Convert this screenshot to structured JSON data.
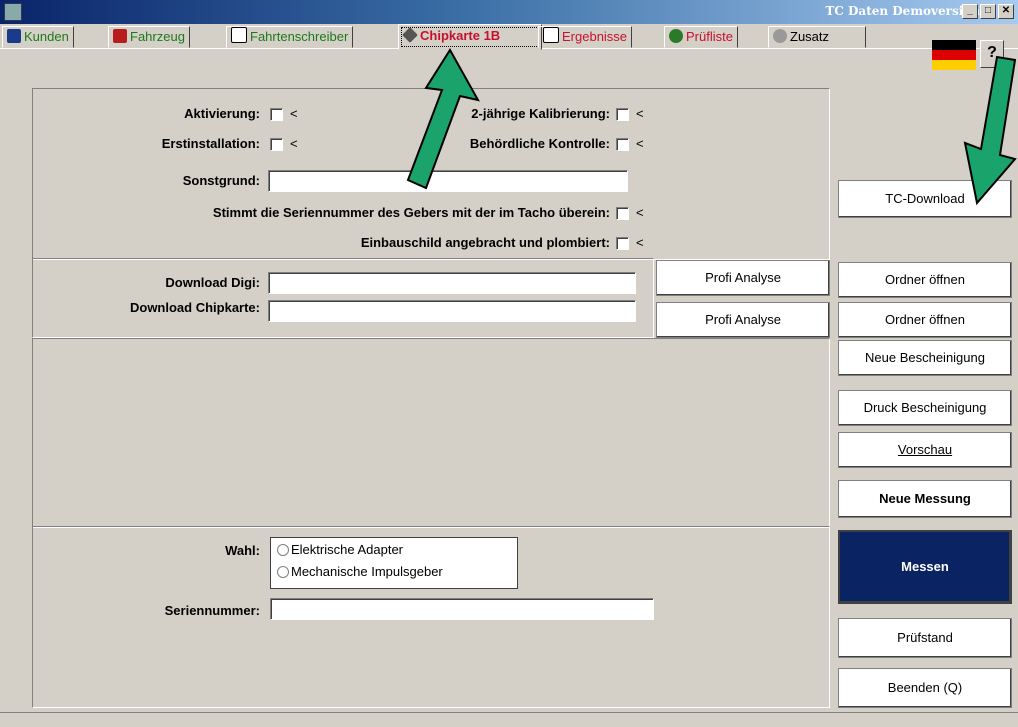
{
  "window": {
    "title": "TC Daten Demoversion",
    "min": "_",
    "max": "□",
    "close": "✕"
  },
  "tabs": [
    {
      "label": "Kunden",
      "icon": "customers-icon"
    },
    {
      "label": "Fahrzeug",
      "icon": "vehicle-icon"
    },
    {
      "label": "Fahrtenschreiber",
      "icon": "tachograph-icon"
    },
    {
      "label": "Chipkarte 1B",
      "icon": "chipcard-icon",
      "active": true
    },
    {
      "label": "Ergebnisse",
      "icon": "results-icon"
    },
    {
      "label": "Prüfliste",
      "icon": "checklist-icon"
    },
    {
      "label": "Zusatz",
      "icon": "extras-icon"
    }
  ],
  "help": "?",
  "section1": {
    "aktivierung": "Aktivierung:",
    "erstinstallation": "Erstinstallation:",
    "sonstgrund": "Sonstgrund:",
    "kalibrierung": "2-jährige Kalibrierung:",
    "kontrolle": "Behördliche Kontrolle:",
    "seriennummer_frage": "Stimmt die Seriennummer des Gebers mit der im Tacho überein:",
    "einbauschild": "Einbauschild angebracht und plombiert:",
    "lt": "<",
    "sonstgrund_value": ""
  },
  "downloads": {
    "digi_label": "Download Digi:",
    "chip_label": "Download Chipkarte:",
    "digi_value": "",
    "chip_value": "",
    "profi": "Profi Analyse"
  },
  "wahl": {
    "label": "Wahl:",
    "options": [
      "Elektrische Adapter",
      "Mechanische Impulsgeber"
    ],
    "serial_label": "Seriennummer:",
    "serial_value": ""
  },
  "buttons": {
    "tc_download": "TC-Download",
    "ordner1": "Ordner öffnen",
    "ordner2": "Ordner öffnen",
    "neue_bescheinigung": "Neue Bescheinigung",
    "druck_bescheinigung": "Druck Bescheinigung",
    "vorschau": "Vorschau",
    "neue_messung": "Neue Messung",
    "messen": "Messen",
    "pruefstand": "Prüfstand",
    "beenden": "Beenden (Q)"
  },
  "colors": {
    "accent": "#0a2463",
    "arrow": "#1aa36a",
    "active_tab": "#c8102e",
    "green_text": "#1b7a1b"
  }
}
